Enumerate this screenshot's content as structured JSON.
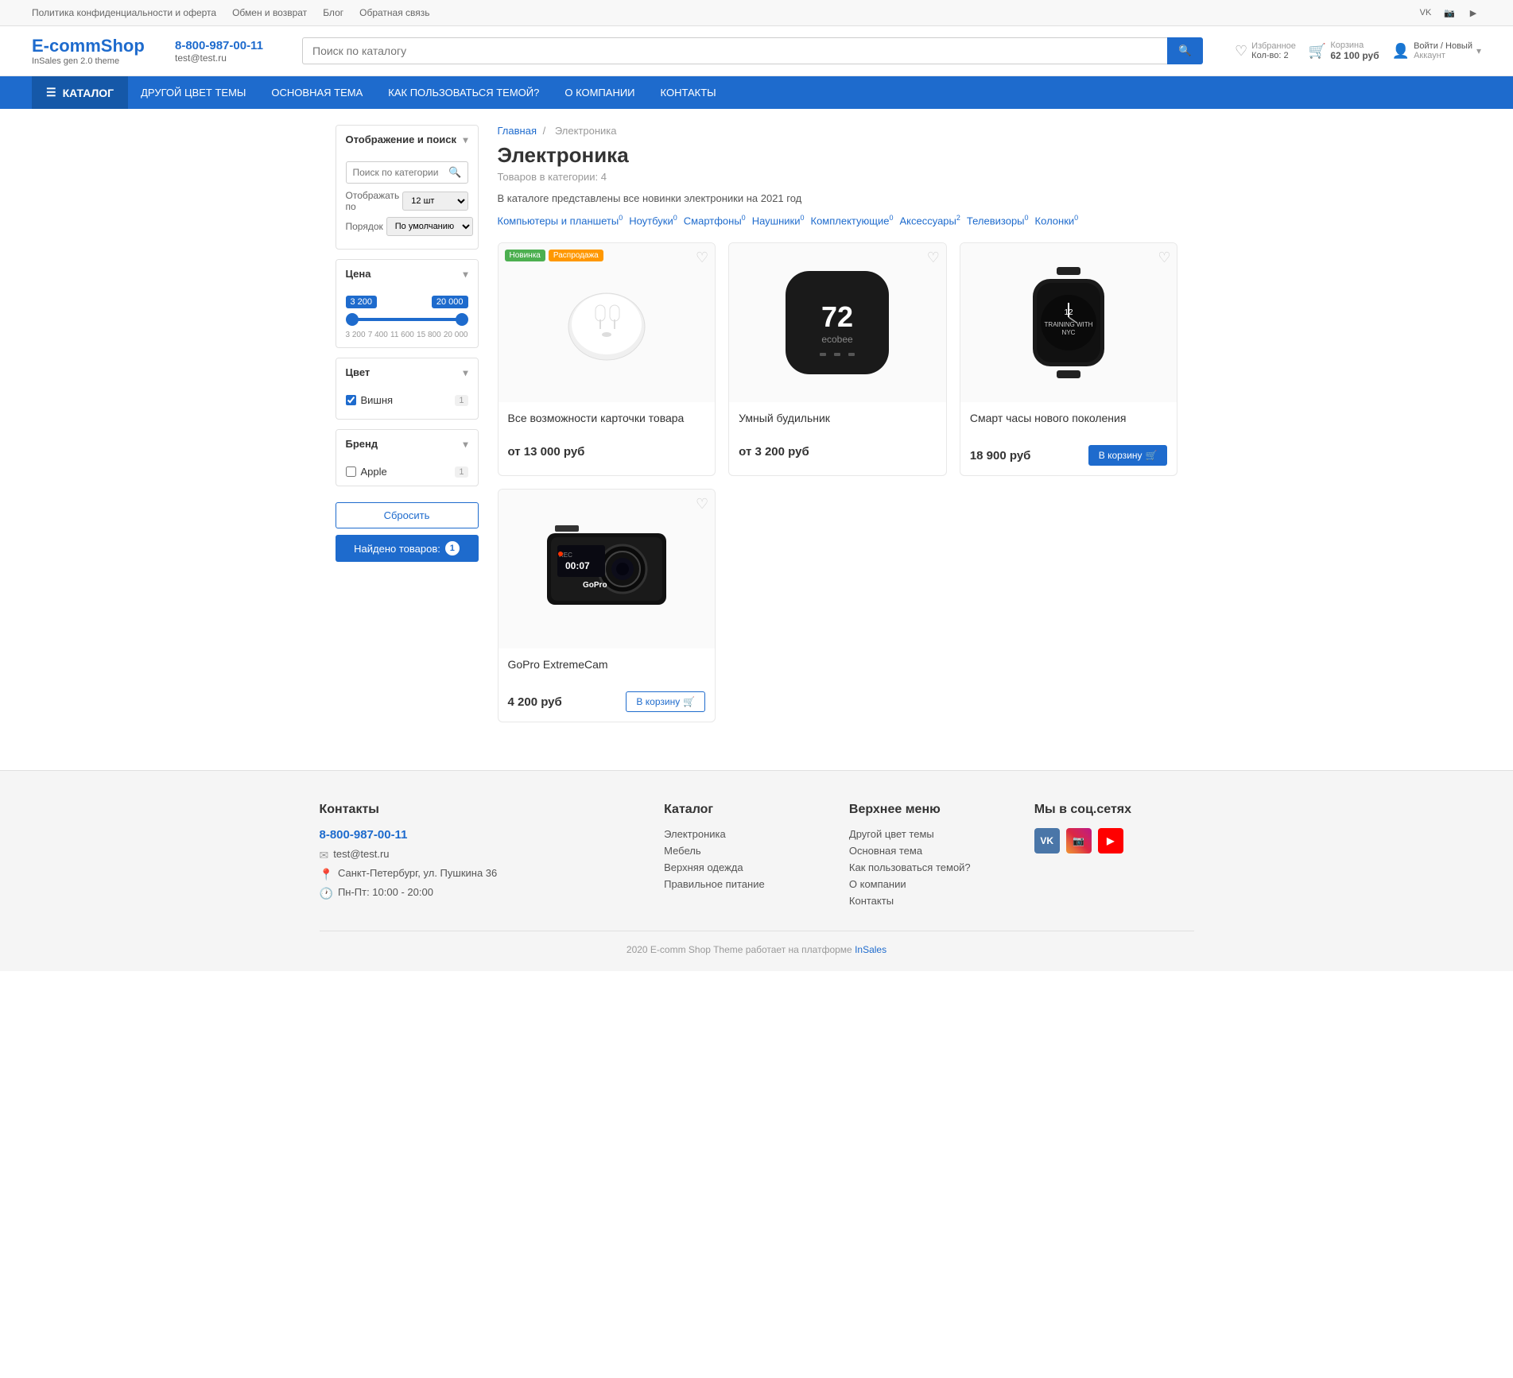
{
  "topbar": {
    "links": [
      {
        "label": "Политика конфиденциальности и оферта"
      },
      {
        "label": "Обмен и возврат"
      },
      {
        "label": "Блог"
      },
      {
        "label": "Обратная связь"
      }
    ]
  },
  "header": {
    "logo_title": "E-commShop",
    "logo_sub": "InSales gen 2.0 theme",
    "phone": "8-800-987-00-11",
    "email": "test@test.ru",
    "search_placeholder": "Поиск по каталогу",
    "wishlist_label": "Избранное",
    "wishlist_count": "Кол-во: 2",
    "cart_label": "Корзина",
    "cart_price": "62 100 руб",
    "account_label": "Войти / Новый",
    "account_sub": "Аккаунт"
  },
  "nav": {
    "catalog_label": "КАТАЛОГ",
    "links": [
      {
        "label": "ДРУГОЙ ЦВЕТ ТЕМЫ"
      },
      {
        "label": "ОСНОВНАЯ ТЕМА"
      },
      {
        "label": "КАК ПОЛЬЗОВАТЬСЯ ТЕМОЙ?"
      },
      {
        "label": "О КОМПАНИИ"
      },
      {
        "label": "КОНТАКТЫ"
      }
    ]
  },
  "sidebar": {
    "section_display_label": "Отображение и поиск",
    "search_category_placeholder": "Поиск по категории",
    "display_by_label": "Отображать по",
    "display_by_value": "12 шт",
    "order_label": "Порядок",
    "order_value": "По умолчанию",
    "section_price_label": "Цена",
    "price_min": "3 200",
    "price_max": "20 000",
    "range_labels": [
      "3 200",
      "7 400",
      "11 600",
      "15 800",
      "20 000"
    ],
    "section_color_label": "Цвет",
    "color_cherry": "Вишня",
    "color_cherry_count": "1",
    "section_brand_label": "Бренд",
    "brand_apple": "Apple",
    "brand_apple_count": "1",
    "reset_label": "Сбросить",
    "found_label": "Найдено товаров:",
    "found_count": "1"
  },
  "breadcrumb": {
    "home": "Главная",
    "separator": "/",
    "current": "Электроника"
  },
  "page": {
    "title": "Электроника",
    "count_text": "Товаров в категории: 4",
    "description": "В каталоге представлены все новинки электроники на 2021 год"
  },
  "subcategories": [
    {
      "label": "Компьютеры и планшеты",
      "count": "0"
    },
    {
      "label": "Ноутбуки",
      "count": "0"
    },
    {
      "label": "Смартфоны",
      "count": "0"
    },
    {
      "label": "Наушники",
      "count": "0"
    },
    {
      "label": "Комплектующие",
      "count": "0"
    },
    {
      "label": "Аксессуары",
      "count": "2"
    },
    {
      "label": "Телевизоры",
      "count": "0"
    },
    {
      "label": "Колонки",
      "count": "0"
    }
  ],
  "products": [
    {
      "id": "1",
      "name": "Все возможности карточки товара",
      "price": "от 13 000 руб",
      "badge_new": "Новинка",
      "badge_sale": "Распродажа",
      "has_cart": false,
      "image_type": "airpods"
    },
    {
      "id": "2",
      "name": "Умный будильник",
      "price": "от 3 200 руб",
      "badge_new": null,
      "badge_sale": null,
      "has_cart": false,
      "image_type": "ecobee"
    },
    {
      "id": "3",
      "name": "Смарт часы нового поколения",
      "price": "18 900 руб",
      "badge_new": null,
      "badge_sale": null,
      "has_cart": true,
      "cart_label": "В корзину",
      "image_type": "watch"
    },
    {
      "id": "4",
      "name": "GoPro ExtremeCam",
      "price": "4 200 руб",
      "badge_new": null,
      "badge_sale": null,
      "has_cart": true,
      "cart_label": "В корзину",
      "image_type": "camera"
    }
  ],
  "footer": {
    "contacts_title": "Контакты",
    "phone": "8-800-987-00-11",
    "email": "test@test.ru",
    "address": "Санкт-Петербург, ул. Пушкина 36",
    "hours": "Пн-Пт: 10:00 - 20:00",
    "catalog_title": "Каталог",
    "catalog_links": [
      {
        "label": "Электроника"
      },
      {
        "label": "Мебель"
      },
      {
        "label": "Верхняя одежда"
      },
      {
        "label": "Правильное питание"
      }
    ],
    "menu_title": "Верхнее меню",
    "menu_links": [
      {
        "label": "Другой цвет темы"
      },
      {
        "label": "Основная тема"
      },
      {
        "label": "Как пользоваться темой?"
      },
      {
        "label": "О компании"
      },
      {
        "label": "Контакты"
      }
    ],
    "social_title": "Мы в соц.сетях",
    "bottom_text": "2020 E-comm Shop Theme",
    "bottom_link_text": "работает на платформе",
    "bottom_link_label": "InSales"
  }
}
